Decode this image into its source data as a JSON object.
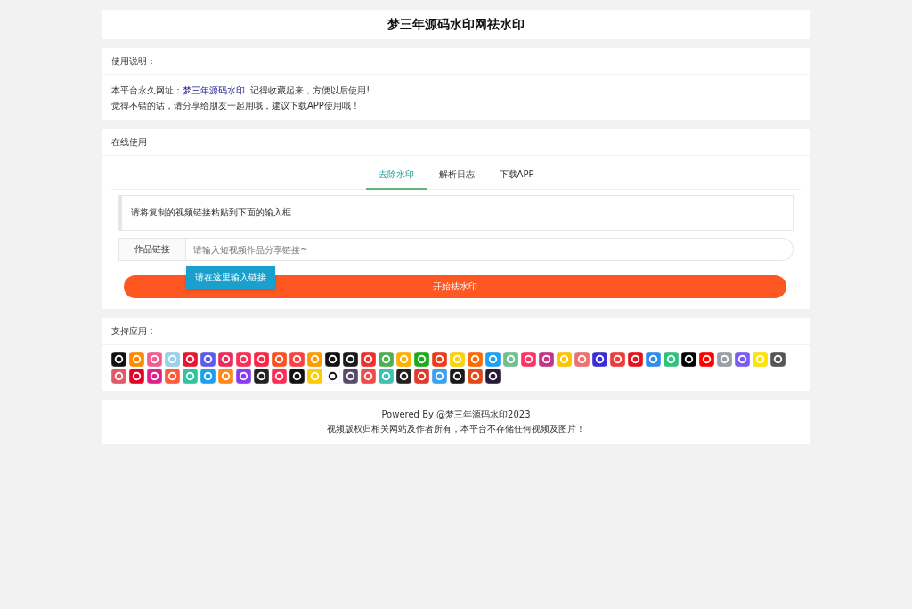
{
  "header": {
    "title": "梦三年源码水印网祛水印"
  },
  "usage": {
    "heading": "使用说明：",
    "line1_prefix": "本平台永久网址：",
    "site_link": "梦三年源码水印",
    "line1_suffix": "记得收藏起来，方便以后使用!",
    "line2": "觉得不错的话，请分享给朋友一起用哦，建议下载APP使用哦！"
  },
  "online": {
    "heading": "在线使用",
    "tabs": [
      {
        "label": "去除水印",
        "selected": true
      },
      {
        "label": "解析日志",
        "selected": false
      },
      {
        "label": "下载APP",
        "selected": false
      }
    ],
    "notice": "请将复制的视频链接粘贴到下面的输入框",
    "field_label": "作品链接",
    "placeholder": "请输入短视频作品分享链接~",
    "tooltip": "请在这里输入链接",
    "submit": "开始祛水印"
  },
  "apps": {
    "heading": "支持应用：",
    "items": [
      {
        "color": "#111111"
      },
      {
        "color": "#ff8a00"
      },
      {
        "color": "#f25d8e"
      },
      {
        "color": "#9ad0ec"
      },
      {
        "color": "#e6162d"
      },
      {
        "color": "#5b5bf0"
      },
      {
        "color": "#ee2a5a"
      },
      {
        "color": "#ff2c55"
      },
      {
        "color": "#ff2442"
      },
      {
        "color": "#ff4e1f"
      },
      {
        "color": "#ff4040"
      },
      {
        "color": "#ff9b00"
      },
      {
        "color": "#111111"
      },
      {
        "color": "#1a1a1a"
      },
      {
        "color": "#f03030"
      },
      {
        "color": "#4cb050"
      },
      {
        "color": "#ffb000"
      },
      {
        "color": "#1aad19"
      },
      {
        "color": "#f03a17"
      },
      {
        "color": "#ffd200"
      },
      {
        "color": "#ff6a00"
      },
      {
        "color": "#1da1f2"
      },
      {
        "color": "#6fbf8f"
      },
      {
        "color": "#ff3366"
      },
      {
        "color": "#c13584"
      },
      {
        "color": "#ffc300"
      },
      {
        "color": "#f07070"
      },
      {
        "color": "#3b2ed8"
      },
      {
        "color": "#f23a3a"
      },
      {
        "color": "#e8101c"
      },
      {
        "color": "#2f8cf0"
      },
      {
        "color": "#2fc27a"
      },
      {
        "color": "#000000"
      },
      {
        "color": "#ff0000"
      },
      {
        "color": "#9aa0a6"
      },
      {
        "color": "#7a5cf0"
      },
      {
        "color": "#ffe400"
      },
      {
        "color": "#555555"
      },
      {
        "color": "#e05a6a"
      },
      {
        "color": "#e60026"
      },
      {
        "color": "#e0208a"
      },
      {
        "color": "#ff5a3c"
      },
      {
        "color": "#2ec4a0"
      },
      {
        "color": "#19a0f0"
      },
      {
        "color": "#ff8a1a"
      },
      {
        "color": "#8a3cf0"
      },
      {
        "color": "#222222"
      },
      {
        "color": "#fe2c55"
      },
      {
        "color": "#111111"
      },
      {
        "color": "#ffcc00"
      },
      {
        "color": "#ffffff"
      },
      {
        "color": "#5a4a6a"
      },
      {
        "color": "#f04a4a"
      },
      {
        "color": "#40c0b0"
      },
      {
        "color": "#222222"
      },
      {
        "color": "#e03a2a"
      },
      {
        "color": "#3aa0f0"
      },
      {
        "color": "#1a1a1a"
      },
      {
        "color": "#e04a1a"
      },
      {
        "color": "#2a1a3a"
      }
    ]
  },
  "footer": {
    "powered": "Powered By @梦三年源码水印2023",
    "copyright": "视频版权归相关网站及作者所有，本平台不存储任何视频及图片！"
  }
}
